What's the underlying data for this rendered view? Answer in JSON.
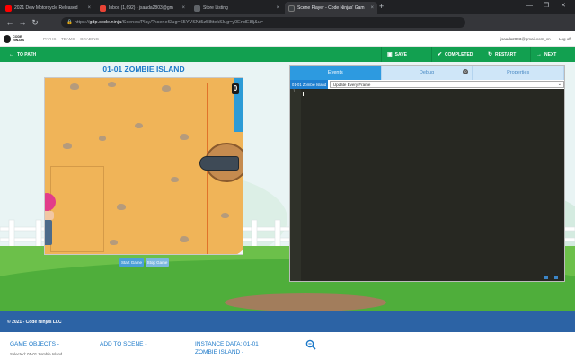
{
  "browser": {
    "tabs": [
      {
        "title": "2021 Dew Motorcycle Released",
        "favicon_color": "#ff0000",
        "active": false
      },
      {
        "title": "Inbox (1,692) - jsaada2803@gm",
        "favicon_color": "#ea4335",
        "active": false
      },
      {
        "title": "Store Listing",
        "favicon_color": "#5f6368",
        "active": false
      },
      {
        "title": "Scene Player - Code Ninjas' Gam",
        "favicon_color": "#3c4043",
        "active": true
      }
    ],
    "new_tab": "+",
    "url_host": "gdp.code.ninja",
    "url_path": "/Scenes/Play/?sceneSlug=65YVSNt5z58ttekSlug=y0EndE8lj&u=",
    "url_prefix": "https://"
  },
  "site": {
    "logo_text": "CODE NINJAS",
    "nav": [
      "PATHS",
      "TEAMS",
      "GRADING"
    ],
    "user_email": "jsaada2803@gmail.com_cn",
    "logout": "Log off"
  },
  "actions": {
    "to_path": "TO PATH",
    "save": "SAVE",
    "completed": "COMPLETED",
    "restart": "RESTART",
    "next": "NEXT"
  },
  "game": {
    "title": "01-01 ZOMBIE ISLAND",
    "counter": "0",
    "start_button": "Start Game",
    "stop_button": "Stop Game"
  },
  "editor": {
    "tabs": [
      "Events",
      "Debug",
      "Properties"
    ],
    "debug_badge": "0",
    "object_label": "01-01 Zombie Island",
    "event_select": "Update Every Frame",
    "line_numbers": [
      "1"
    ]
  },
  "footer": {
    "copyright": "© 2021 - Code Ninjas LLC"
  },
  "bottom": {
    "game_objects": "GAME OBJECTS -",
    "selected": "Selected: 01-01 Zombie Island",
    "add_to_scene": "ADD TO SCENE -",
    "instance_data_line1": "INSTANCE DATA: 01-01",
    "instance_data_line2": "ZOMBIE ISLAND -"
  },
  "colors": {
    "green_bar": "#12a050",
    "footer_blue": "#2c63a5",
    "accent_blue": "#1b78c8",
    "sand": "#f0b458",
    "editor_bg": "#272822"
  },
  "icons": [
    "back-icon",
    "forward-icon",
    "reload-icon",
    "zoom-search-icon",
    "cannon"
  ]
}
